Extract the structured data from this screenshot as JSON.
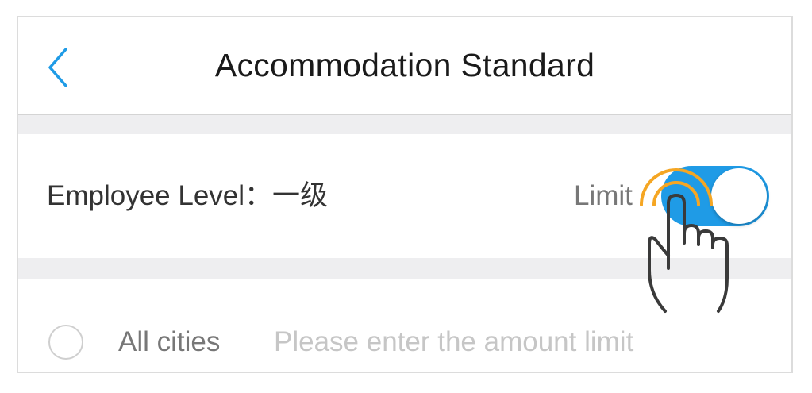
{
  "header": {
    "back_icon": "chevron-left-icon",
    "title": "Accommodation Standard"
  },
  "employee_level": {
    "label": "Employee Level：一级",
    "limit_label": "Limit",
    "limit_enabled": true
  },
  "city_row": {
    "radio_selected": false,
    "label": "All cities",
    "amount_value": "",
    "amount_placeholder": "Please enter the amount limit"
  },
  "overlay": {
    "icon": "tap-gesture-hand-icon"
  },
  "colors": {
    "accent": "#1f9be6",
    "tap_ripple": "#f5a623",
    "section_gap": "#eeeef0"
  }
}
